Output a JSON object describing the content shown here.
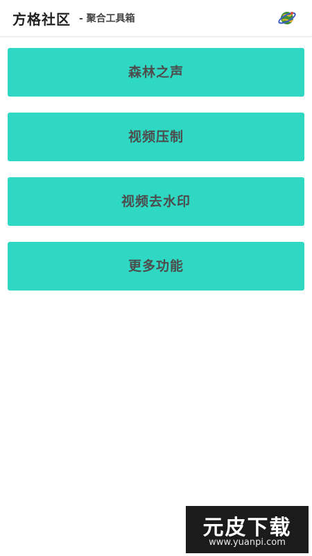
{
  "header": {
    "title": "方格社区",
    "subtitle": "- 聚合工具箱",
    "icon": "planet-icon"
  },
  "menu": {
    "items": [
      {
        "label": "森林之声"
      },
      {
        "label": "视频压制"
      },
      {
        "label": "视频去水印"
      },
      {
        "label": "更多功能"
      }
    ]
  },
  "watermark": {
    "brand": "元皮下载",
    "url": "www.yuanpi.com"
  },
  "colors": {
    "accent": "#2ed8c3",
    "button_text": "#4d4d4d",
    "header_text": "#222222"
  }
}
